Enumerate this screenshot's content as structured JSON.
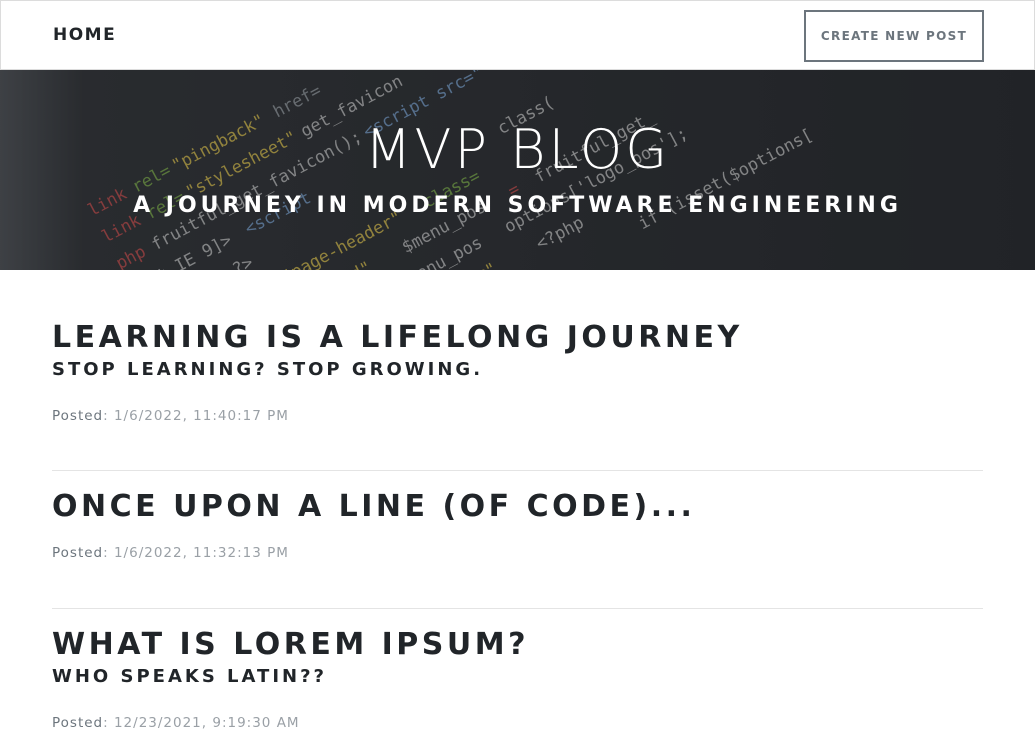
{
  "nav": {
    "home_label": "HOME",
    "create_label": "CREATE NEW POST"
  },
  "masthead": {
    "title": "MVP BLOG",
    "subtitle": "A JOURNEY IN MODERN SOFTWARE ENGINEERING"
  },
  "posts": [
    {
      "title": "LEARNING IS A LIFELONG JOURNEY",
      "subtitle": "STOP LEARNING? STOP GROWING.",
      "posted_label": "Posted",
      "date": ": 1/6/2022, 11:40:17 PM"
    },
    {
      "title": "ONCE UPON A LINE (OF CODE)...",
      "subtitle": "",
      "posted_label": "Posted",
      "date": ": 1/6/2022, 11:32:13 PM"
    },
    {
      "title": "WHAT IS LOREM IPSUM?",
      "subtitle": "WHO SPEAKS LATIN??",
      "posted_label": "Posted",
      "date": ": 12/23/2021, 9:19:30 AM"
    }
  ]
}
